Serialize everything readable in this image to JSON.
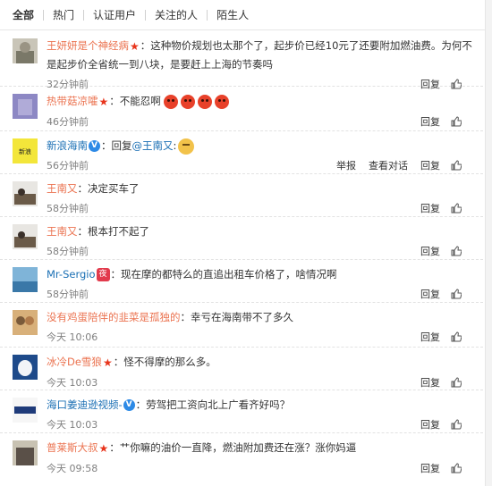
{
  "tabs": [
    "全部",
    "热门",
    "认证用户",
    "关注的人",
    "陌生人"
  ],
  "reply_label": "回复",
  "report_label": "举报",
  "view_dialog_label": "查看对话",
  "comments": [
    {
      "user": "王妍妍是个神经病",
      "sep": "：",
      "text": "这种物价规划也太那个了，起步价已经10元了还要附加燃油费。为何不是起步价全省统一到八块，是要赶上上海的节奏吗",
      "time": "32分钟前"
    },
    {
      "user": "热带菇凉嚯",
      "sep": "：",
      "text": "不能忍啊",
      "time": "46分钟前"
    },
    {
      "user": "新浪海南",
      "sep": "：",
      "text": "回复",
      "mention": "@王南又",
      "mention_sep": ":",
      "time": "56分钟前"
    },
    {
      "user": "王南又",
      "sep": "：",
      "text": "决定买车了",
      "time": "58分钟前"
    },
    {
      "user": "王南又",
      "sep": "：",
      "text": "根本打不起了",
      "time": "58分钟前"
    },
    {
      "user": "Mr-Sergio",
      "sep": "：",
      "text": "现在摩的都特么的直追出租车价格了，啥情况啊",
      "time": "58分钟前",
      "badge": "夜"
    },
    {
      "user": "没有鸡蛋陪伴的韭菜是孤独的",
      "sep": "：",
      "text": "幸亏在海南带不了多久",
      "time": "今天 10:06"
    },
    {
      "user": "冰冷De雪狼",
      "sep": "：",
      "text": "怪不得摩的那么多。",
      "time": "今天 10:03"
    },
    {
      "user": "海口姜迪逊视频-",
      "sep": "：",
      "text": "劳驾把工资向北上广看齐好吗？",
      "time": "今天 10:03"
    },
    {
      "user": "普莱斯大叔",
      "sep": "：",
      "text": "艹你嘛的油价一直降，燃油附加费还在涨？涨你妈逼",
      "time": "今天 09:58"
    }
  ]
}
